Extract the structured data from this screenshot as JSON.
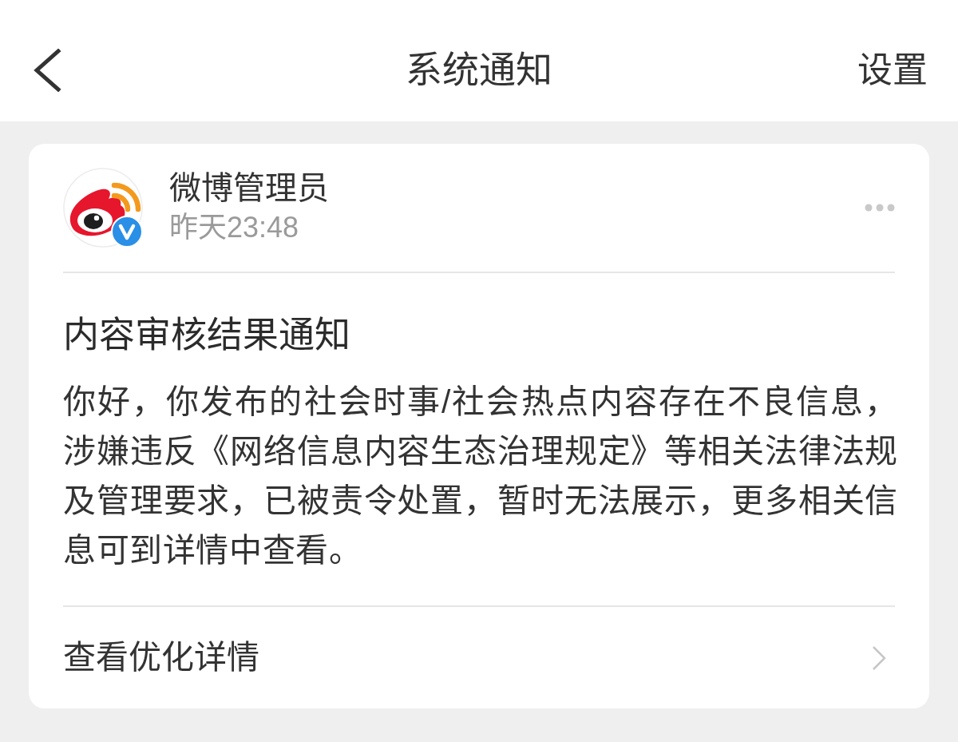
{
  "header": {
    "title": "系统通知",
    "action": "设置"
  },
  "notification": {
    "sender": {
      "name": "微博管理员",
      "verified": true,
      "time": "昨天23:48"
    },
    "title": "内容审核结果通知",
    "body": "你好，你发布的社会时事/社会热点内容存在不良信息，涉嫌违反《网络信息内容生态治理规定》等相关法律法规及管理要求，已被责令处置，暂时无法展示，更多相关信息可到详情中查看。",
    "link": "查看优化详情"
  }
}
